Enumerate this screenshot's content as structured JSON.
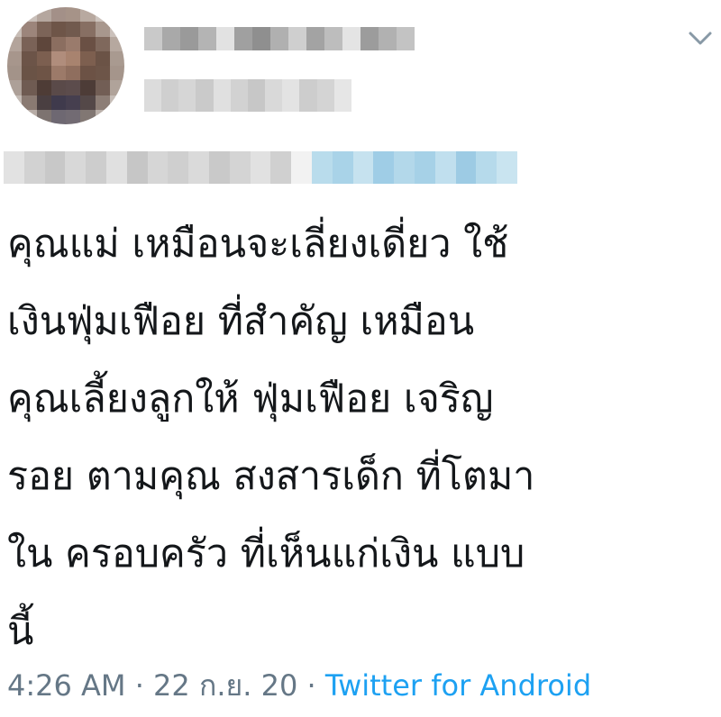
{
  "tweet": {
    "text_lines": [
      "คุณแม่ เหมือนจะเลี่ยงเดี่ยว ใช้",
      "เงินฟุ่มเฟือย ที่สำคัญ เหมือน",
      "คุณเลี้ยงลูกให้ ฟุ่มเฟือย เจริญ",
      "รอย ตามคุณ  สงสารเด็ก ที่โตมา",
      "ใน ครอบครัว ที่เห็นแก่เงิน  แบบ",
      "นี้"
    ]
  },
  "meta": {
    "time": "4:26 AM",
    "dot": "·",
    "date": "22 ก.ย. 20",
    "source": "Twitter for Android"
  },
  "icons": {
    "more": "chevron-down-icon"
  },
  "colors": {
    "text": "#14171a",
    "meta": "#657786",
    "link": "#1da1f2",
    "chevron": "#8899a6"
  }
}
